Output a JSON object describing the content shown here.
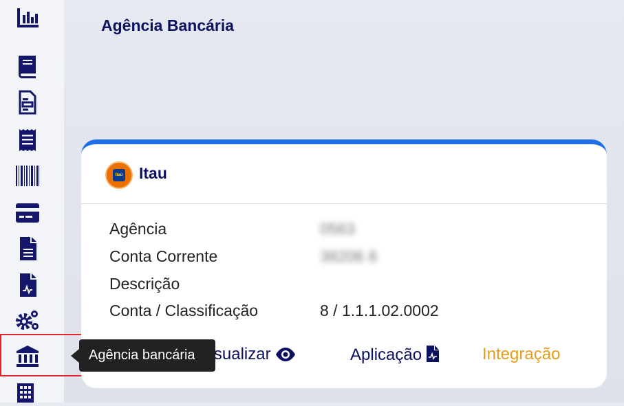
{
  "page": {
    "title": "Agência Bancária"
  },
  "sidebar": {
    "items": [
      {
        "icon": "bar-chart-icon"
      },
      {
        "icon": "book-icon"
      },
      {
        "icon": "document-list-icon"
      },
      {
        "icon": "receipt-icon"
      },
      {
        "icon": "barcode-icon"
      },
      {
        "icon": "credit-card-icon"
      },
      {
        "icon": "file-text-icon"
      },
      {
        "icon": "file-chart-icon"
      },
      {
        "icon": "gears-icon"
      },
      {
        "icon": "bank-icon",
        "active": true
      },
      {
        "icon": "building-icon"
      }
    ],
    "tooltip": "Agência bancária"
  },
  "card": {
    "bank_name": "Itau",
    "logo_text": "Itaú",
    "fields": [
      {
        "label": "Agência",
        "value": "0563"
      },
      {
        "label": "Conta Corrente",
        "value": "38206 8"
      },
      {
        "label": "Descrição",
        "value": ""
      },
      {
        "label": "Conta / Classificação",
        "value": "8 / 1.1.1.02.0002"
      }
    ],
    "actions": {
      "visualizar": "Visualizar",
      "aplicacao": "Aplicação",
      "integracao": "Integração"
    }
  },
  "colors": {
    "accent": "#1e6fe6",
    "navy": "#0c1160",
    "integration": "#e89c1c",
    "highlight": "#e0252b"
  }
}
